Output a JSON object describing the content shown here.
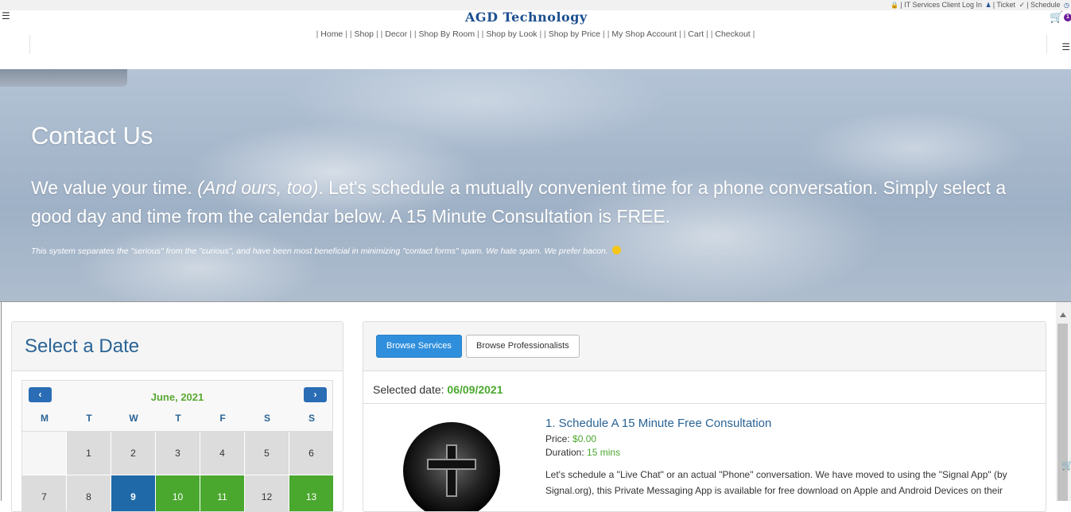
{
  "util": {
    "client_login": "| IT Services Client Log In",
    "ticket": "| Ticket",
    "schedule": "| Schedule"
  },
  "brand": "AGD Technology",
  "cart_count": "1",
  "nav": [
    "Home",
    "Shop",
    "Decor",
    "Shop By Room",
    "Shop by Look",
    "Shop by Price",
    "My Shop Account",
    "Cart",
    "Checkout"
  ],
  "hero": {
    "title": "Contact Us",
    "lead_a": "We value your time. ",
    "lead_em": "(And ours, too)",
    "lead_b": ". Let's schedule a mutually convenient time for a phone conversation. Simply select a good day and time from the calendar below. A 15 Minute Consultation is FREE.",
    "small": "This system separates the \"serious\" from the \"curious\", and have been most beneficial in minimizing \"contact forms\" spam. We hate spam. We prefer bacon."
  },
  "date_panel": {
    "heading": "Select a Date",
    "month": "June, 2021",
    "prev": "‹",
    "next": "›",
    "dow": [
      "M",
      "T",
      "W",
      "T",
      "F",
      "S",
      "S"
    ],
    "cells": [
      {
        "d": "",
        "s": "empty"
      },
      {
        "d": "1",
        "s": "na"
      },
      {
        "d": "2",
        "s": "na"
      },
      {
        "d": "3",
        "s": "na"
      },
      {
        "d": "4",
        "s": "na"
      },
      {
        "d": "5",
        "s": "na"
      },
      {
        "d": "6",
        "s": "na"
      },
      {
        "d": "7",
        "s": "na"
      },
      {
        "d": "8",
        "s": "na"
      },
      {
        "d": "9",
        "s": "sel"
      },
      {
        "d": "10",
        "s": "avail"
      },
      {
        "d": "11",
        "s": "avail"
      },
      {
        "d": "12",
        "s": "na"
      },
      {
        "d": "13",
        "s": "avail"
      }
    ]
  },
  "services": {
    "browse_services": "Browse Services",
    "browse_pros": "Browse Professionalists",
    "selected_label": "Selected date:",
    "selected_value": "06/09/2021",
    "item": {
      "title": "1. Schedule A 15 Minute Free Consultation",
      "price_label": "Price:",
      "price": "$0.00",
      "duration_label": "Duration:",
      "duration": "15 mins",
      "desc": "Let's schedule a \"Live Chat\" or an actual \"Phone\" conversation. We have moved to using the \"Signal App\" (by Signal.org), this Private Messaging App is available for free download on Apple and Android Devices on their"
    }
  },
  "colors": {
    "brand": "#1b4f8f",
    "available": "#4aa82e",
    "selected": "#1f69a8",
    "primary": "#2f8fdc"
  }
}
